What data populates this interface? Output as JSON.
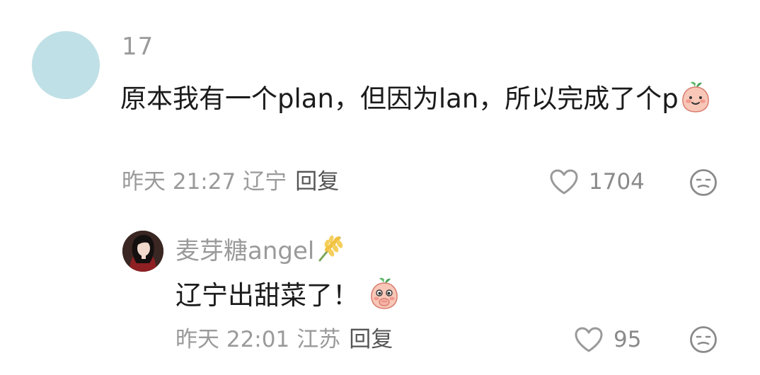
{
  "comment": {
    "username": "17",
    "text": "原本我有一个plan，但因为lan，所以完成了个p",
    "emoji_icon": "smiling-radish-emoji-icon",
    "time": "昨天 21:27",
    "location": "辽宁",
    "reply_label": "回复",
    "like_count": "1704",
    "avatar_color": "#bfe0e6"
  },
  "reply": {
    "username": "麦芽糖angel",
    "badge_icon": "wheat-icon",
    "text": "辽宁出甜菜了！",
    "emoji_icon": "shy-radish-emoji-icon",
    "time": "昨天 22:01",
    "location": "江苏",
    "reply_label": "回复",
    "like_count": "95"
  }
}
